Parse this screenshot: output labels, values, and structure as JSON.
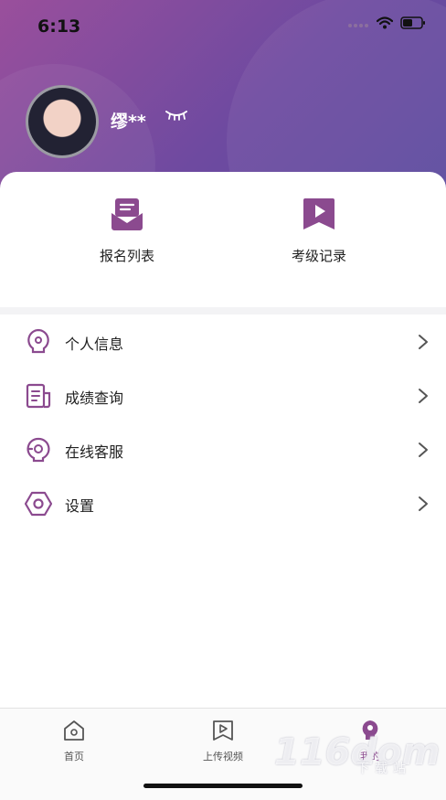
{
  "status_bar": {
    "time": "6:13"
  },
  "profile": {
    "username": "缪**"
  },
  "quick_actions": [
    {
      "label": "报名列表",
      "icon": "envelope-icon"
    },
    {
      "label": "考级记录",
      "icon": "play-icon"
    }
  ],
  "menu": [
    {
      "label": "个人信息",
      "icon": "lightbulb-icon"
    },
    {
      "label": "成绩查询",
      "icon": "document-icon"
    },
    {
      "label": "在线客服",
      "icon": "headset-icon"
    },
    {
      "label": "设置",
      "icon": "settings-icon"
    }
  ],
  "tabbar": {
    "tabs": [
      {
        "label": "首页",
        "icon": "home-icon"
      },
      {
        "label": "上传视频",
        "icon": "upload-video-icon"
      },
      {
        "label": "我的",
        "icon": "profile-icon"
      }
    ],
    "active_index": 2
  },
  "watermark": {
    "text": "116d",
    "suffix": "om",
    "sub": "下载站"
  },
  "colors": {
    "accent": "#8b4a8f",
    "header_start": "#9a4f9c",
    "header_end": "#5a4a9e"
  }
}
